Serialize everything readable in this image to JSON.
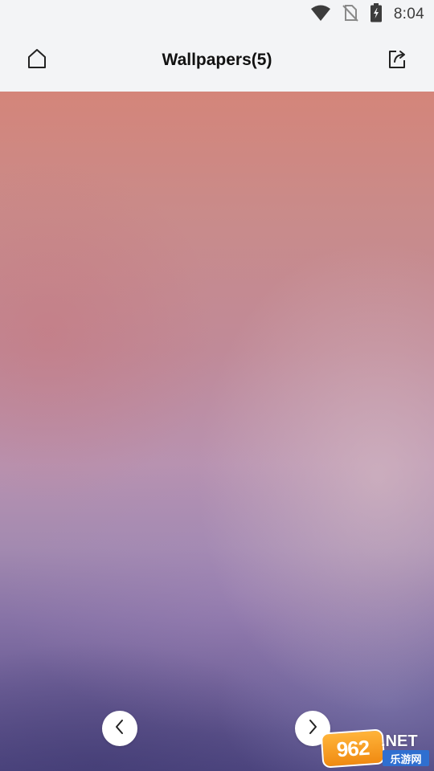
{
  "status_bar": {
    "time": "8:04",
    "icons": [
      "wifi-icon",
      "no-sim-icon",
      "battery-charging-icon"
    ]
  },
  "toolbar": {
    "title": "Wallpapers(5)",
    "left_icon": "home-icon",
    "right_icon": "share-icon"
  },
  "wallpaper": {
    "colors": [
      "#d4857a",
      "#c08a98",
      "#b892b0",
      "#8672a6",
      "#4e4680"
    ]
  },
  "navigation": {
    "prev_icon": "chevron-left-icon",
    "next_icon": "chevron-right-icon"
  },
  "watermark": {
    "badge": "962",
    "suffix": ".NET",
    "caption": "乐游网"
  },
  "colors": {
    "bar_background": "#f3f4f6",
    "title_text": "#111111",
    "icon_stroke": "#222222"
  }
}
